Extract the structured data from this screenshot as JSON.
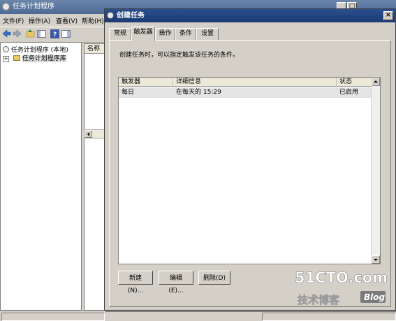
{
  "background_window": {
    "title": "任务计划程序",
    "controls": [
      "_",
      "□",
      "×"
    ],
    "menu": [
      "文件(F)",
      "操作(A)",
      "查看(V)",
      "帮助(H)"
    ],
    "tree": {
      "root": "任务计划程序 (本地)",
      "child": "任务计划程序库",
      "expander": "+"
    },
    "list_header": "名称"
  },
  "dialog": {
    "title": "创建任务",
    "close": "×",
    "tabs": [
      "常规",
      "触发器",
      "操作",
      "条件",
      "设置"
    ],
    "active_tab": 1,
    "description": "创建任务时，可以指定触发该任务的条件。",
    "table": {
      "columns": [
        "触发器",
        "详细信息",
        "状态"
      ],
      "rows": [
        {
          "trigger": "每日",
          "details": "在每天的 15:29",
          "status": "已启用"
        }
      ]
    },
    "buttons": {
      "new": "新建(N)...",
      "edit": "编辑(E)...",
      "delete": "删除(D)"
    }
  },
  "watermark": {
    "site": "51CTO.com",
    "caption": "技术博客",
    "badge": "Blog"
  },
  "colors": {
    "bg_title": "#4d6a96",
    "dlg_title": "#1c3a74",
    "face": "#d4d0c8",
    "row_highlight": "#e4e4e4"
  }
}
